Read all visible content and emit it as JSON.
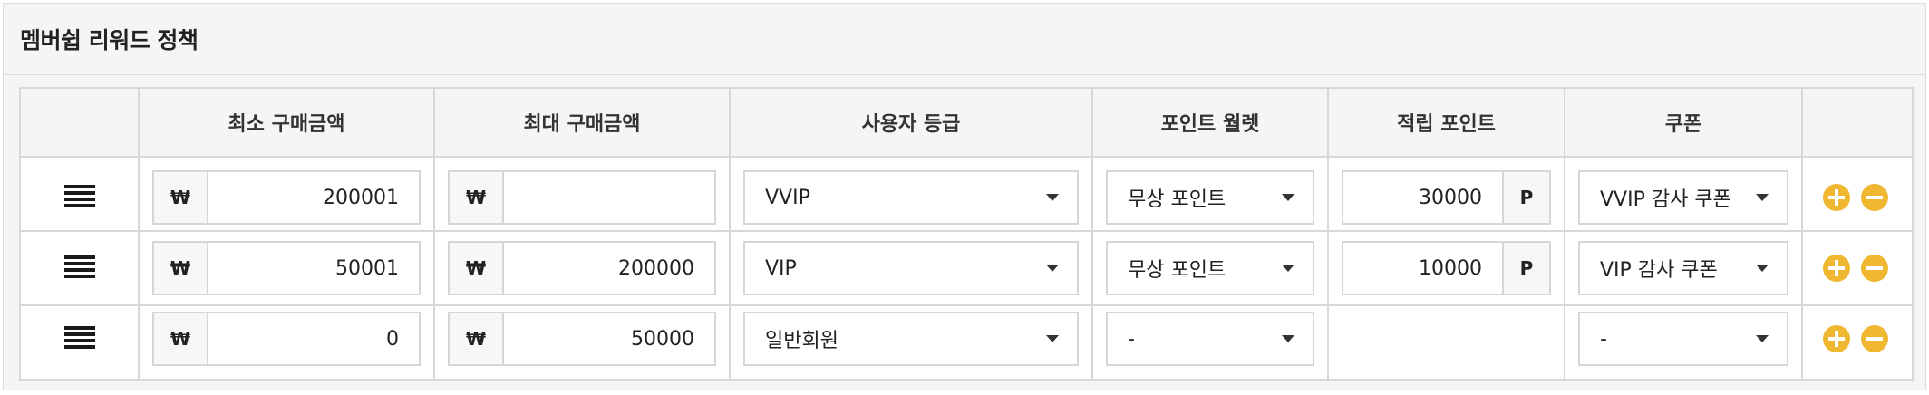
{
  "panel": {
    "title": "멤버쉽 리워드 정책"
  },
  "table": {
    "headers": [
      "",
      "최소 구매금액",
      "최대 구매금액",
      "사용자 등급",
      "포인트 월렛",
      "적립 포인트",
      "쿠폰",
      ""
    ],
    "currency_symbol": "₩",
    "point_unit": "P",
    "rows": [
      {
        "min_amount": "200001",
        "max_amount": "",
        "grade": "VVIP",
        "wallet": "무상 포인트",
        "points": "30000",
        "coupon": "VVIP 감사 쿠폰"
      },
      {
        "min_amount": "50001",
        "max_amount": "200000",
        "grade": "VIP",
        "wallet": "무상 포인트",
        "points": "10000",
        "coupon": "VIP 감사 쿠폰"
      },
      {
        "min_amount": "0",
        "max_amount": "50000",
        "grade": "일반회원",
        "wallet": "-",
        "points": null,
        "coupon": "-"
      }
    ]
  },
  "colors": {
    "accent": "#f0b730",
    "border": "#d8d8d8",
    "header_bg": "#f5f5f5"
  },
  "icons": {
    "drag": "drag-handle-icon",
    "add": "plus-circle-icon",
    "remove": "minus-circle-icon"
  }
}
